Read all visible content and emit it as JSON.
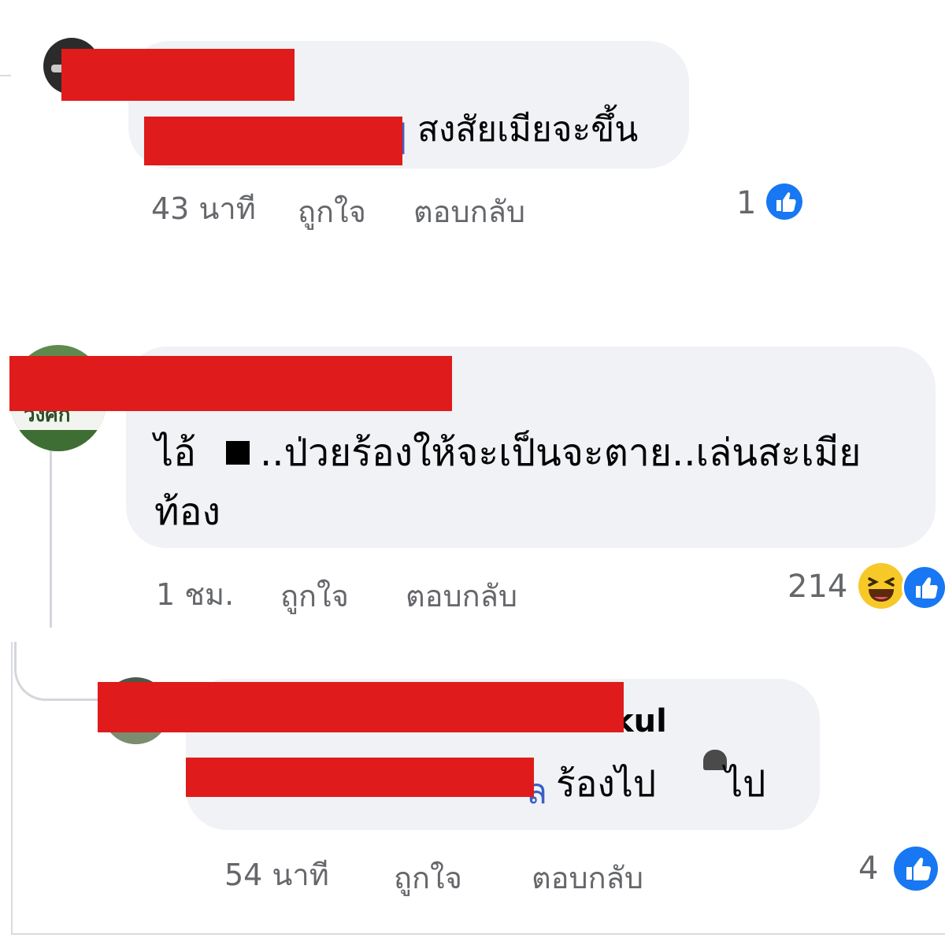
{
  "comments": [
    {
      "text": "สงสัยเมียจะขึ้น",
      "time": "43 นาที",
      "like_label": "ถูกใจ",
      "reply_label": "ตอบกลับ",
      "reaction_count": "1",
      "reaction_icons": [
        "like-icon"
      ]
    },
    {
      "text_prefix": "ไอ้",
      "text_line1": "..ป่วยร้องให้จะเป็นจะตาย..เล่นสะเมีย",
      "text_line2": "ท้อง",
      "avatar_text": "วงศก",
      "time": "1 ชม.",
      "like_label": "ถูกใจ",
      "reply_label": "ตอบกลับ",
      "reaction_count": "214",
      "reaction_icons": [
        "haha-icon",
        "like-icon"
      ]
    },
    {
      "name_fragment": "kul",
      "link_fragment": "ล",
      "text": "ร้องไป",
      "text_tail": "ไป",
      "time": "54 นาที",
      "like_label": "ถูกใจ",
      "reply_label": "ตอบกลับ",
      "reaction_count": "4",
      "reaction_icons": [
        "like-icon"
      ]
    }
  ],
  "colors": {
    "bubble": "#f0f2f5",
    "redaction": "#e01b1b",
    "meta_text": "#65676b",
    "link": "#3b5fc4",
    "like_blue": "#1877f2",
    "haha_yellow": "#f7c928"
  }
}
